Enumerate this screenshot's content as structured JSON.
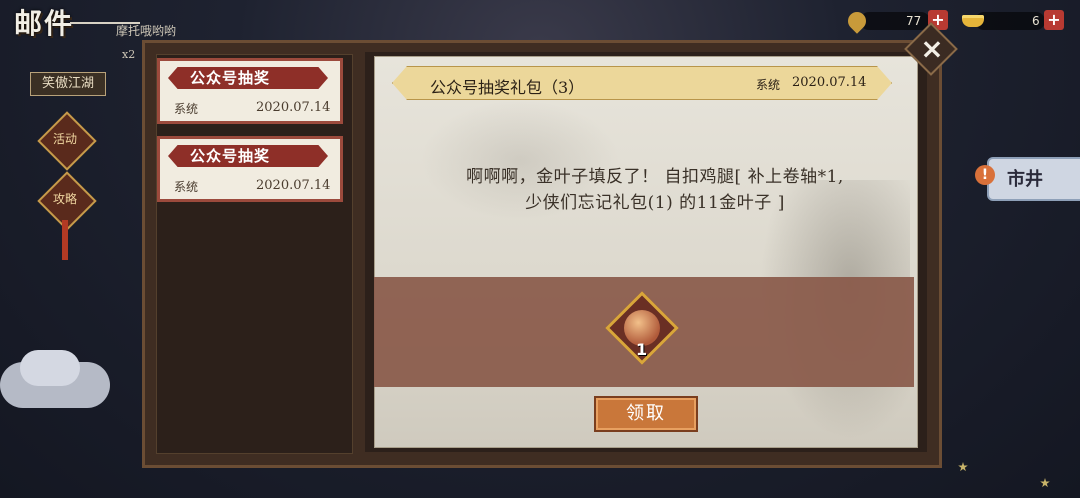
{
  "app": {
    "title": "邮件",
    "subtitle": "摩托哦哟哟",
    "badge": "x2",
    "side_label": "笑傲江湖",
    "pendant1": "活动",
    "pendant2": "攻略"
  },
  "currencies": [
    {
      "icon": "gold-leaf-icon",
      "value": "77"
    },
    {
      "icon": "gold-ingot-icon",
      "value": "6"
    }
  ],
  "market": {
    "label": "市井",
    "alert": "!"
  },
  "mail_list": [
    {
      "title": "公众号抽奖",
      "sender": "系统",
      "date": "2020.07.14"
    },
    {
      "title": "公众号抽奖",
      "sender": "系统",
      "date": "2020.07.14"
    }
  ],
  "mail_detail": {
    "title": "公众号抽奖礼包（3）",
    "sender": "系统",
    "date": "2020.07.14",
    "body_line1": "啊啊啊，金叶子填反了！ 自扣鸡腿[ 补上卷轴*1,",
    "body_line2": "少侠们忘记礼包(1) 的11金叶子 ]",
    "reward": {
      "icon": "drumstick-reward-icon",
      "count": "1"
    },
    "claim_label": "领取"
  },
  "close_label": "×"
}
